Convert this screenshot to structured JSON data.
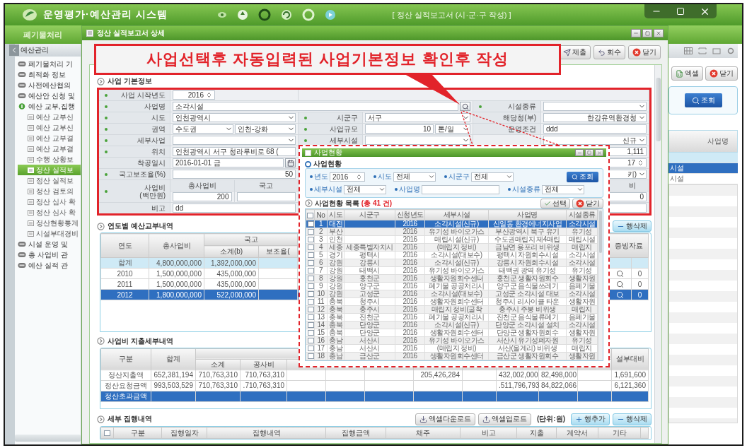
{
  "app": {
    "title": "운영평가·예산관리 시스템",
    "screen_title": "[ 정산 실적보고서 (시·군·구 작성) ]"
  },
  "menu_bar": {
    "label": "폐기물처리"
  },
  "sidebar": {
    "title": "예산관리",
    "items": [
      {
        "label": "폐기물처리 기",
        "expanded": false
      },
      {
        "label": "최적화 정보",
        "expanded": false
      },
      {
        "label": "사전예산협의",
        "expanded": false
      },
      {
        "label": "예산안 신청 및",
        "expanded": false
      },
      {
        "label": "예산 교부,집행",
        "expanded": true,
        "children": [
          {
            "label": "예산 교부신",
            "selected": false
          },
          {
            "label": "예산 교부신",
            "selected": false
          },
          {
            "label": "예산 교부결",
            "selected": false
          },
          {
            "label": "예산 교부결",
            "selected": false
          },
          {
            "label": "수행 상황보",
            "selected": false
          },
          {
            "label": "정산 실적보",
            "selected": true
          },
          {
            "label": "정산 실적보",
            "selected": false
          },
          {
            "label": "정산 검토의",
            "selected": false
          },
          {
            "label": "정산 심사 확",
            "selected": false
          },
          {
            "label": "정산 심사 확",
            "selected": false
          },
          {
            "label": "정산현황통계",
            "selected": false
          },
          {
            "label": "시설부대경비",
            "selected": false
          }
        ]
      },
      {
        "label": "시설 운영 및",
        "expanded": false
      },
      {
        "label": "총 사업비 관",
        "expanded": false
      },
      {
        "label": "예산 실적 관",
        "expanded": false
      }
    ]
  },
  "background_list": {
    "buttons": [
      {
        "label": "엑셀",
        "kind": "excel"
      },
      {
        "label": "닫기",
        "kind": "close"
      }
    ],
    "search_button": "조회",
    "column": "사업명",
    "rows": [
      {
        "text": "시설",
        "selected": true
      },
      {
        "text": "시설",
        "selected": false
      }
    ]
  },
  "dialog": {
    "title": "정산 실적보고서 상세",
    "toolbar": [
      {
        "label": "제출",
        "kind": "submit"
      },
      {
        "label": "회수",
        "kind": "recall"
      },
      {
        "label": "닫기",
        "kind": "close"
      }
    ]
  },
  "callout": {
    "text": "사업선택후 자동입력된 사업기본정보 확인후 작성"
  },
  "basic_info": {
    "title": "사업 기본정보",
    "rows": [
      [
        {
          "kind": "label",
          "text": "사업 시작년도",
          "required": true
        },
        {
          "kind": "spin",
          "value": "2016"
        },
        {
          "kind": "blank"
        }
      ],
      [
        {
          "kind": "label",
          "text": "사업명",
          "required": true
        },
        {
          "kind": "search",
          "value": "소각시설"
        },
        {
          "kind": "merged"
        },
        {
          "kind": "merged"
        },
        {
          "kind": "label",
          "text": "시설종류",
          "required": true
        },
        {
          "kind": "select"
        }
      ],
      [
        {
          "kind": "label",
          "text": "시도",
          "required": true
        },
        {
          "kind": "select",
          "value": "인천광역시"
        },
        {
          "kind": "label",
          "text": "시군구",
          "required": true
        },
        {
          "kind": "select",
          "value": "서구"
        },
        {
          "kind": "label",
          "text": "해당청(부)",
          "required": false
        },
        {
          "kind": "select",
          "value": "한강유역환경청"
        }
      ],
      [
        {
          "kind": "label",
          "text": "권역",
          "required": true
        },
        {
          "kind": "select_pair",
          "values": [
            "수도권",
            "인천-강화"
          ]
        },
        {
          "kind": "label",
          "text": "사업규모",
          "required": true
        },
        {
          "kind": "unit",
          "value": "10",
          "unit": "톤/일"
        },
        {
          "kind": "label",
          "text": "운영조건",
          "required": false
        },
        {
          "kind": "text",
          "value": "ddd"
        }
      ],
      [
        {
          "kind": "label",
          "text": "세부사업",
          "required": true
        },
        {
          "kind": "select"
        },
        {
          "kind": "label",
          "text": "세부시설",
          "required": true
        },
        {
          "kind": "select"
        },
        {
          "kind": "blank"
        },
        {
          "kind": "select",
          "value": "신규"
        }
      ],
      [
        {
          "kind": "label",
          "text": "위치",
          "required": true
        },
        {
          "kind": "text",
          "value": "인천광역시 서구 청라루비로 68 ("
        },
        {
          "kind": "blank"
        },
        {
          "kind": "number",
          "value": "1,111"
        }
      ],
      [
        {
          "kind": "label",
          "text": "착공일시",
          "required": false
        },
        {
          "kind": "date",
          "value": "2016-01-01 금"
        },
        {
          "kind": "blank"
        },
        {
          "kind": "spin",
          "value": "17"
        }
      ],
      [
        {
          "kind": "label",
          "text": "국고보조율(%)",
          "required": true
        },
        {
          "kind": "number",
          "value": "50"
        },
        {
          "kind": "blank"
        },
        {
          "kind": "select",
          "value": "키)"
        }
      ],
      [
        {
          "kind": "label",
          "lines": [
            "사업비",
            "(백만원)"
          ],
          "required": true
        },
        {
          "kind": "header_pair",
          "texts": [
            "총사업비",
            "국고"
          ]
        },
        {
          "kind": "blank"
        },
        {
          "kind": "header",
          "text": "비"
        }
      ],
      [
        {
          "kind": "amounts",
          "value": "200"
        },
        {
          "kind": "blank"
        },
        {
          "kind": "number",
          "value": "0"
        }
      ],
      [
        {
          "kind": "label",
          "text": "비고",
          "required": false
        },
        {
          "kind": "text",
          "value": "dd"
        },
        {
          "kind": "blank"
        },
        {
          "kind": "input"
        }
      ]
    ]
  },
  "project_lookup": {
    "title": "사업현황",
    "section": "사업현황",
    "filter_rows": [
      [
        {
          "label": "년도",
          "kind": "spin",
          "value": "2016"
        },
        {
          "label": "시도",
          "kind": "select",
          "value": "전체"
        },
        {
          "label": "시군구",
          "kind": "select",
          "value": "전체"
        }
      ],
      [
        {
          "label": "세부시설",
          "kind": "select",
          "value": "전체"
        },
        {
          "label": "사업명",
          "kind": "text"
        },
        {
          "label": "시설종류",
          "kind": "select",
          "value": "전체"
        }
      ]
    ],
    "search_button": "조회",
    "list_title": "사업현황 목록",
    "count": "(총 41 건)",
    "buttons": [
      {
        "label": "선택",
        "kind": "select"
      },
      {
        "label": "닫기",
        "kind": "close"
      }
    ],
    "all_checked": false,
    "columns": [
      "No",
      "시도",
      "시군구",
      "신청년도",
      "세부시설",
      "사업명",
      "시설종류"
    ],
    "rows": [
      {
        "no": "1",
        "sido": "대전",
        "year": "2016",
        "facility": "소각시설(신규)",
        "name": "신일동 환경에너지사업",
        "type": "소각시설",
        "selected": true,
        "checked": false
      },
      {
        "no": "2",
        "sido": "부산",
        "year": "2016",
        "facility": "유기성 바이오가스",
        "name": "부산광역시 북구 유기",
        "type": "유기성",
        "selected": false,
        "checked": false
      },
      {
        "no": "3",
        "sido": "인천",
        "year": "2016",
        "facility": "매립시설(신규)",
        "name": "수도권매립지 제4매립",
        "type": "매립시설",
        "selected": false,
        "checked": false
      },
      {
        "no": "4",
        "sido": "세종",
        "sigungu": "세종특별자치시",
        "year": "2016",
        "facility": "(매립지 정비)",
        "name": "금남면 용포리 비위생",
        "type": "매립지",
        "selected": false,
        "checked": false
      },
      {
        "no": "5",
        "sido": "경기",
        "sigungu": "평택시",
        "year": "2016",
        "facility": "소각시설(대보수)",
        "name": "평택시 자원회수시설",
        "type": "소각시설",
        "selected": false,
        "checked": false
      },
      {
        "no": "6",
        "sido": "강원",
        "sigungu": "강릉시",
        "year": "2016",
        "facility": "소각시설(신규)",
        "name": "강릉시 자원회수시설",
        "type": "소각시설",
        "selected": false,
        "checked": false
      },
      {
        "no": "7",
        "sido": "강원",
        "sigungu": "태백시",
        "year": "2016",
        "facility": "유기성 바이오가스",
        "name": "태백권 광역 유기성",
        "type": "유기성",
        "selected": false,
        "checked": false
      },
      {
        "no": "8",
        "sido": "강원",
        "sigungu": "홍천군",
        "year": "2016",
        "facility": "생활자원회수센터",
        "name": "홍천군 생활자원회수",
        "type": "생활자원",
        "selected": false,
        "checked": false
      },
      {
        "no": "9",
        "sido": "강원",
        "sigungu": "양구군",
        "year": "2016",
        "facility": "폐기물 공공처리시",
        "name": "양구군 음식물쓰레기",
        "type": "음폐기물",
        "selected": false,
        "checked": false
      },
      {
        "no": "10",
        "sido": "강원",
        "sigungu": "고성군",
        "year": "2016",
        "facility": "소각시설(대보수)",
        "name": "고성군 소각시설 대보",
        "type": "소각시설",
        "selected": false,
        "checked": false
      },
      {
        "no": "11",
        "sido": "충북",
        "sigungu": "청주시",
        "year": "2016",
        "facility": "생활자원회수센터",
        "name": "청주시 리사이클 타운",
        "type": "생활자원",
        "selected": false,
        "checked": false
      },
      {
        "no": "12",
        "sido": "충북",
        "sigungu": "충주시",
        "year": "2016",
        "facility": "매립지 정비(굴착",
        "name": "충주시 주봉 비위생",
        "type": "매립지",
        "selected": false,
        "checked": false
      },
      {
        "no": "13",
        "sido": "충북",
        "sigungu": "진천군",
        "year": "2016",
        "facility": "폐기물 공공처리시",
        "name": "진천군 음식물류폐기",
        "type": "음폐기물",
        "selected": false,
        "checked": false
      },
      {
        "no": "14",
        "sido": "충북",
        "sigungu": "단양군",
        "year": "2016",
        "facility": "소각시설(신규)",
        "name": "단양군 소각시설 설치",
        "type": "소각시설",
        "selected": false,
        "checked": false
      },
      {
        "no": "15",
        "sido": "충북",
        "sigungu": "단양군",
        "year": "2016",
        "facility": "생활자원회수센터",
        "name": "단양군 생활자원회수",
        "type": "생활자원",
        "selected": false,
        "checked": false
      },
      {
        "no": "16",
        "sido": "충남",
        "sigungu": "서산시",
        "year": "2016",
        "facility": "유기성 바이오가스",
        "name": "서산시 유기성폐자원",
        "type": "유기성",
        "selected": false,
        "checked": false
      },
      {
        "no": "17",
        "sido": "충남",
        "sigungu": "서산시",
        "year": "2016",
        "facility": "(매립지 정비)",
        "name": "서산(울계리) 비위생",
        "type": "매립지",
        "selected": false,
        "checked": false
      },
      {
        "no": "18",
        "sido": "충남",
        "sigungu": "금산군",
        "year": "2016",
        "facility": "생활자원회수센터",
        "name": "금산군 생활자원회수",
        "type": "생활자원",
        "selected": false,
        "checked": false
      }
    ]
  },
  "yearly_budget": {
    "title": "연도별 예산교부내역",
    "delete_button": "행삭제",
    "headers": {
      "year": "연도",
      "total": "총사업비",
      "national": "국고",
      "subtotal": "소계(b)",
      "rate": "보조율(",
      "evidence": "증빙자료"
    },
    "rows": [
      {
        "kind": "total",
        "year": "합계",
        "total": "4,800,000,000",
        "subtotal": "1,392,000,000",
        "selected": false
      },
      {
        "kind": "year",
        "year": "2010",
        "total": "1,500,000,000",
        "subtotal": "435,000,000",
        "evidence_count": "0",
        "selected": false
      },
      {
        "kind": "year",
        "year": "2011",
        "total": "1,500,000,000",
        "subtotal": "435,000,000",
        "evidence_count": "0",
        "selected": false
      },
      {
        "kind": "year",
        "year": "2012",
        "total": "1,800,000,000",
        "subtotal": "522,000,000",
        "evidence_count": "0",
        "selected": true
      }
    ]
  },
  "expenditure": {
    "title": "사업비 지출세부내역",
    "headers": {
      "category": "구분",
      "total": "합계",
      "subtotal": "소계",
      "construction": "공사비",
      "overhead": "설부대비"
    },
    "rows": [
      {
        "category": "정산지출액",
        "total": "652,381,194",
        "subtotal": "710,763,310",
        "construction": "710,763,310",
        "column_8": "205,426,284",
        "column_10": "432,002,000",
        "column_11": "82,498,000",
        "overhead": "1,691,600",
        "selected": false
      },
      {
        "category": "정산요청금액",
        "total": "993,503,529",
        "subtotal": "710,763,310",
        "construction": ".710,763,310",
        "column_10": ".511,796,793",
        "column_11": "84,822,066",
        "overhead": "6,121,360",
        "selected": false
      },
      {
        "category": "정산초과금액",
        "selected": true
      }
    ]
  },
  "execution": {
    "title": "세부 집행내역",
    "buttons": [
      {
        "label": "엑셀다운로드",
        "kind": "download"
      },
      {
        "label": "엑셀업로드",
        "kind": "upload"
      }
    ],
    "unit": "(단위:원)",
    "row_buttons": [
      {
        "label": "행추가",
        "kind": "add"
      },
      {
        "label": "행삭제",
        "kind": "delete"
      }
    ],
    "all_checked": false,
    "columns": [
      "구분",
      "집행일자",
      "집행내역",
      "집행금액",
      "채주",
      "비고",
      "지출",
      "계약서",
      "기타"
    ]
  }
}
